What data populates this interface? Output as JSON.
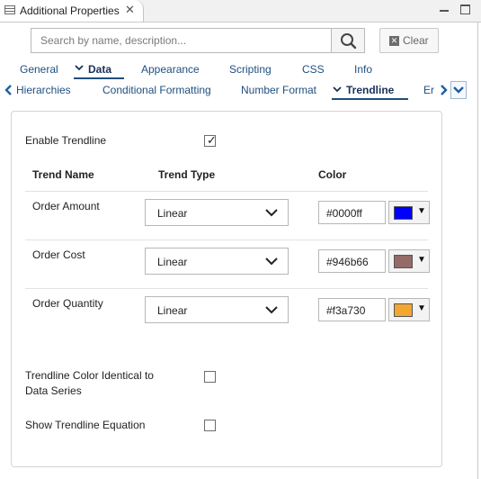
{
  "view": {
    "title": "Additional Properties",
    "close_glyph": "✕"
  },
  "search": {
    "placeholder": "Search by name, description...",
    "value": ""
  },
  "clear_button": {
    "label": "Clear"
  },
  "tabs_row1": [
    {
      "label": "General"
    },
    {
      "label": "Data",
      "active": true
    },
    {
      "label": "Appearance"
    },
    {
      "label": "Scripting"
    },
    {
      "label": "CSS"
    },
    {
      "label": "Info"
    }
  ],
  "tabs_row2": [
    {
      "label": "Hierarchies"
    },
    {
      "label": "Conditional Formatting"
    },
    {
      "label": "Number Format"
    },
    {
      "label": "Trendline",
      "active": true
    },
    {
      "label": "Er"
    }
  ],
  "trendline": {
    "enable_label": "Enable Trendline",
    "enable_checked": true,
    "headers": {
      "name": "Trend Name",
      "type": "Trend Type",
      "color": "Color"
    },
    "rows": [
      {
        "name": "Order Amount",
        "type": "Linear",
        "hex": "#0000ff",
        "swatch": "#0000ff"
      },
      {
        "name": "Order Cost",
        "type": "Linear",
        "hex": "#946b66",
        "swatch": "#946b66"
      },
      {
        "name": "Order Quantity",
        "type": "Linear",
        "hex": "#f3a730",
        "swatch": "#f3a730"
      }
    ],
    "identical_label_line1": "Trendline Color Identical to",
    "identical_label_line2": "Data Series",
    "identical_checked": false,
    "equation_label": "Show Trendline Equation",
    "equation_checked": false
  },
  "icons": {
    "view": "properties-view-icon",
    "search": "search-icon",
    "clear": "clear-x-icon",
    "minimize": "minimize-icon",
    "maximize": "maximize-icon",
    "scroll_left": "chevron-left-icon",
    "scroll_right": "chevron-right-icon",
    "tab_overflow": "chevron-down-icon"
  }
}
